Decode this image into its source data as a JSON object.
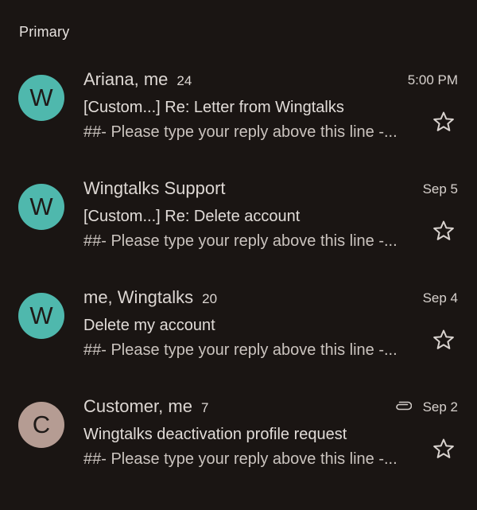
{
  "section": {
    "title": "Primary"
  },
  "colors": {
    "background": "#1a1513",
    "avatar_w": "#4fb8ad",
    "avatar_c": "#b59c93",
    "text_primary": "#ddd7d3",
    "text_secondary": "#cbc4bf"
  },
  "emails": [
    {
      "avatar_letter": "W",
      "avatar_color": "#4fb8ad",
      "sender": "Ariana, me",
      "count": "24",
      "date": "5:00 PM",
      "subject": "[Custom...] Re: Letter from Wingtalks",
      "snippet": "##- Please type your reply above this line -...",
      "has_attachment": false,
      "starred": false
    },
    {
      "avatar_letter": "W",
      "avatar_color": "#4fb8ad",
      "sender": "Wingtalks Support",
      "count": "",
      "date": "Sep 5",
      "subject": "[Custom...] Re: Delete account",
      "snippet": "##- Please type your reply above this line -...",
      "has_attachment": false,
      "starred": false
    },
    {
      "avatar_letter": "W",
      "avatar_color": "#4fb8ad",
      "sender": "me, Wingtalks",
      "count": "20",
      "date": "Sep 4",
      "subject": "Delete my account",
      "snippet": "##- Please type your reply above this line -...",
      "has_attachment": false,
      "starred": false
    },
    {
      "avatar_letter": "C",
      "avatar_color": "#b59c93",
      "sender": "Customer, me",
      "count": "7",
      "date": "Sep 2",
      "subject": "Wingtalks deactivation profile request",
      "snippet": "##- Please type your reply above this line -...",
      "has_attachment": true,
      "starred": false
    }
  ]
}
